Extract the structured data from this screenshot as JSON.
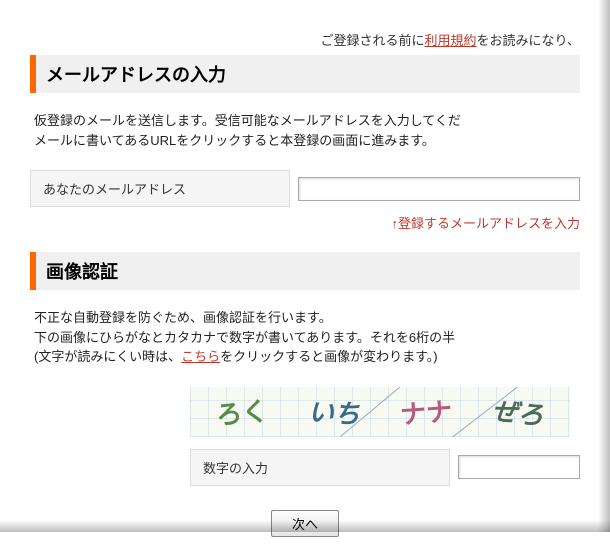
{
  "preNote": {
    "before": "ご登録される前に",
    "link": "利用規約",
    "after": "をお読みになり、"
  },
  "emailSection": {
    "heading": "メールアドレスの入力",
    "descLine1": "仮登録のメールを送信します。受信可能なメールアドレスを入力してくだ",
    "descLine2": "メールに書いてあるURLをクリックすると本登録の画面に進みます。",
    "fieldLabel": "あなたのメールアドレス",
    "fieldValue": "",
    "hint": "↑登録するメールアドレスを入力"
  },
  "captchaSection": {
    "heading": "画像認証",
    "descLine1": "不正な自動登録を防ぐため、画像認証を行います。",
    "descLine2": "下の画像にひらがなとカタカナで数字が書いてあります。それを6桁の半",
    "descLine3a": "(文字が読みにくい時は、",
    "descLine3Link": "こちら",
    "descLine3b": "をクリックすると画像が変わります。)",
    "chars": [
      "ろく",
      "いち",
      "ナナ",
      "ぜろ"
    ],
    "digitLabel": "数字の入力",
    "digitValue": ""
  },
  "nextButton": "次へ"
}
